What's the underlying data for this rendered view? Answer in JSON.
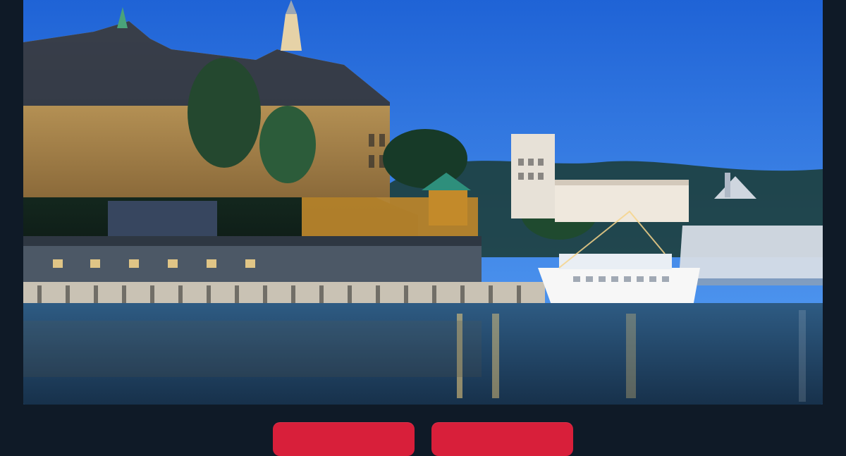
{
  "colors": {
    "page_background": "#0f1a27",
    "button_red": "#d81f3a",
    "sky_top": "#1f63d6",
    "sky_bottom": "#5aa2f5",
    "water": "#24486b"
  },
  "photo": {
    "icon_name": "harbor-photo"
  },
  "actions": {
    "left_button_label": "",
    "right_button_label": ""
  }
}
